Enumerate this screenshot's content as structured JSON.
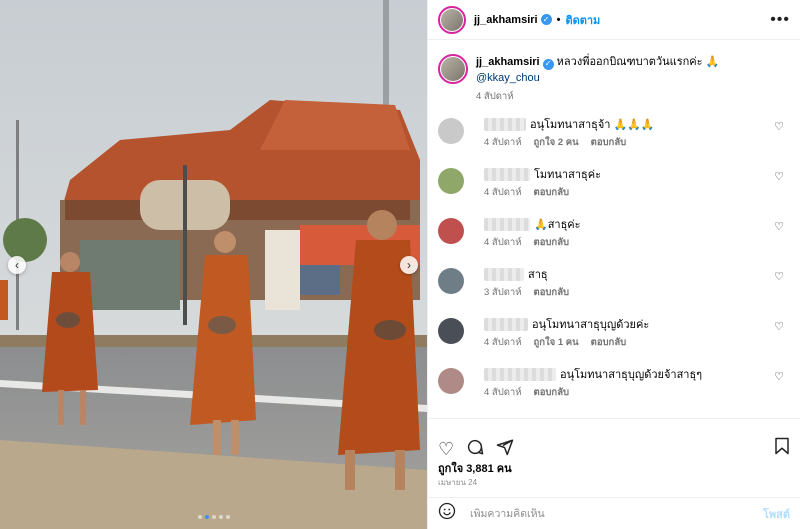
{
  "header": {
    "username": "jj_akhamsiri",
    "separator": "•",
    "follow_label": "ติดตาม",
    "more_icon": "more-horizontal-icon"
  },
  "caption": {
    "username": "jj_akhamsiri",
    "text": "หลวงพี่ออกบิณฑบาตวันแรกค่ะ 🙏",
    "mention": "@kkay_chou",
    "time": "4 สัปดาห์"
  },
  "comments": [
    {
      "text": "อนุโมทนาสาธุจ้า 🙏🙏🙏",
      "time": "4 สัปดาห์",
      "likes": "ถูกใจ 2 คน",
      "reply": "ตอบกลับ",
      "avatar_color": "#c9c9c9"
    },
    {
      "text": "โมทนาสาธุค่ะ",
      "time": "4 สัปดาห์",
      "likes": "",
      "reply": "ตอบกลับ",
      "avatar_color": "#8fa86a"
    },
    {
      "text": "🙏สาธุค่ะ",
      "time": "4 สัปดาห์",
      "likes": "",
      "reply": "ตอบกลับ",
      "avatar_color": "#c0504d"
    },
    {
      "text": "สาธุ",
      "time": "3 สัปดาห์",
      "likes": "",
      "reply": "ตอบกลับ",
      "avatar_color": "#6f7d86"
    },
    {
      "text": "อนุโมทนาสาธุบุญด้วยค่ะ",
      "time": "4 สัปดาห์",
      "likes": "ถูกใจ 1 คน",
      "reply": "ตอบกลับ",
      "avatar_color": "#4a4f57"
    },
    {
      "text": "อนุโมทนาสาธุบุญด้วยจ้าสาธุๆ",
      "time": "4 สัปดาห์",
      "likes": "",
      "reply": "ตอบกลับ",
      "avatar_color": "#b08a86"
    }
  ],
  "actions": {
    "like_icon": "heart-icon",
    "comment_icon": "comment-icon",
    "share_icon": "send-icon",
    "save_icon": "bookmark-icon"
  },
  "likes_text": "ถูกใจ 3,881 คน",
  "date_text": "เมษายน 24",
  "composer": {
    "emoji_icon": "emoji-icon",
    "placeholder": "เพิ่มความคิดเห็น",
    "post_label": "โพสต์"
  },
  "carousel": {
    "prev_icon": "chevron-left-icon",
    "next_icon": "chevron-right-icon",
    "dot_count": 5,
    "active_index": 1
  }
}
